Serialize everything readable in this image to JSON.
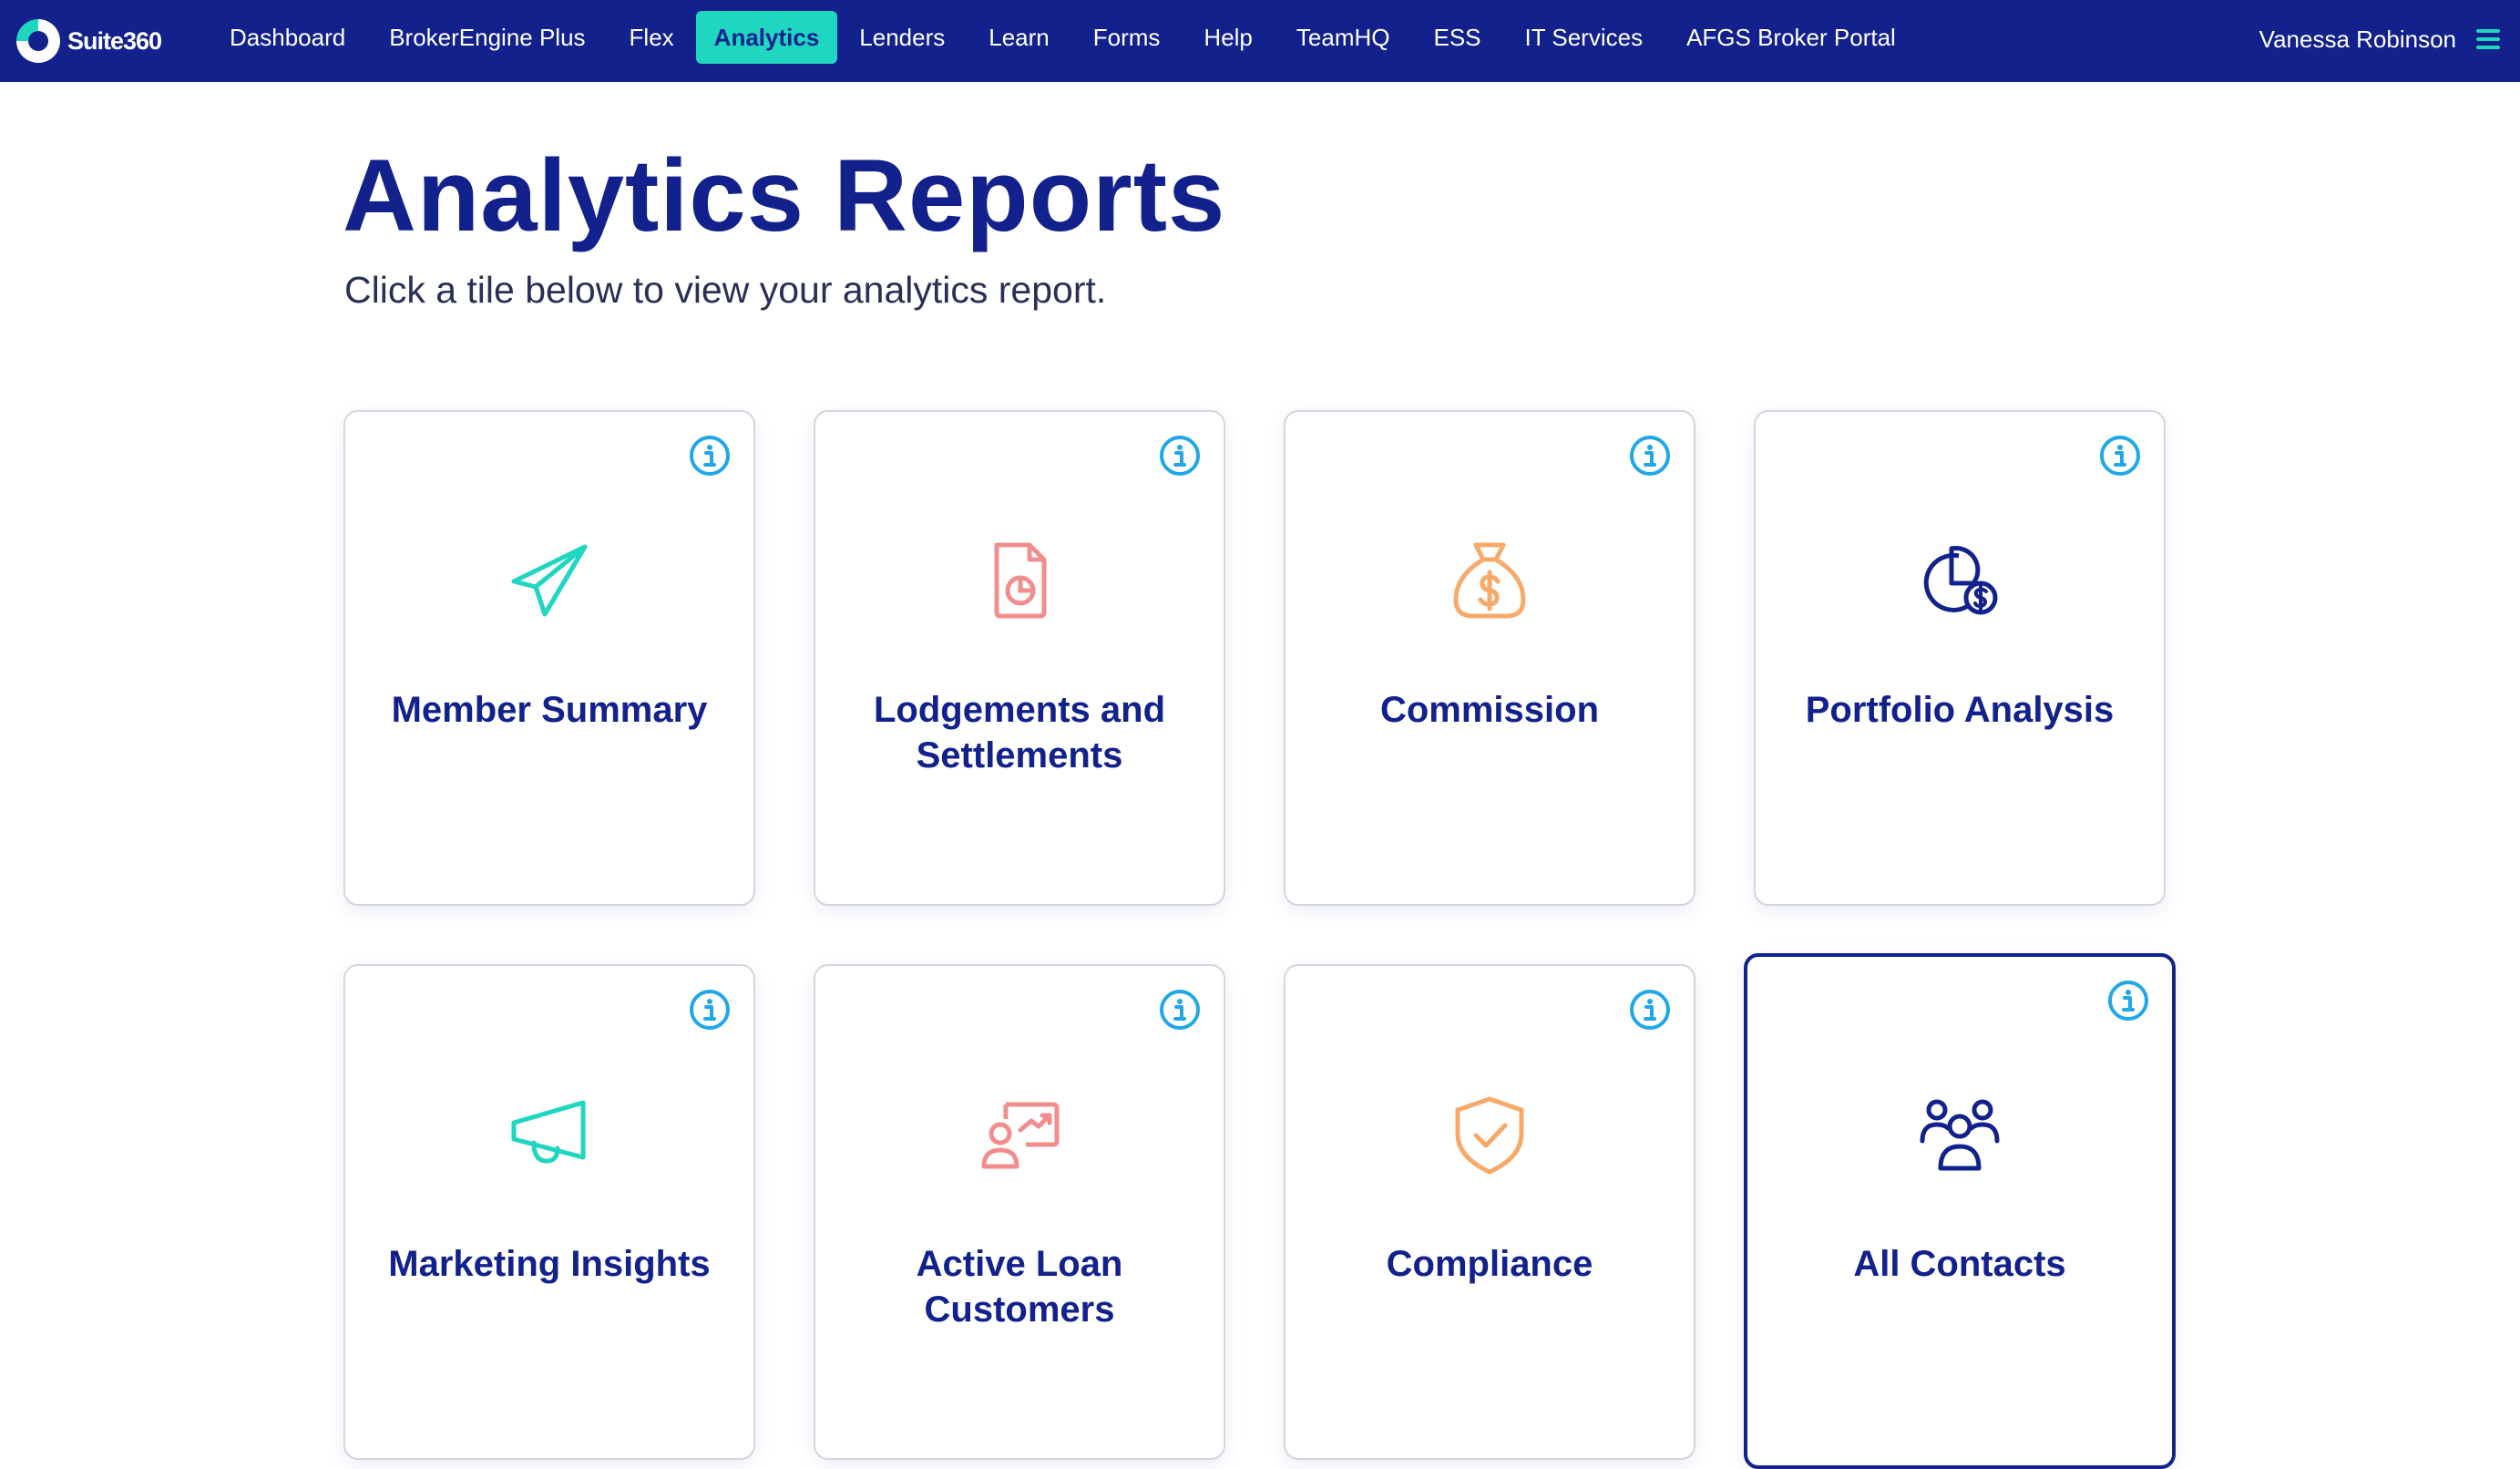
{
  "app": {
    "name": "Suite360"
  },
  "nav": {
    "items": [
      {
        "label": "Dashboard"
      },
      {
        "label": "BrokerEngine Plus"
      },
      {
        "label": "Flex"
      },
      {
        "label": "Analytics",
        "active": true
      },
      {
        "label": "Lenders"
      },
      {
        "label": "Learn"
      },
      {
        "label": "Forms"
      },
      {
        "label": "Help"
      },
      {
        "label": "TeamHQ"
      },
      {
        "label": "ESS"
      },
      {
        "label": "IT Services"
      },
      {
        "label": "AFGS Broker Portal"
      }
    ],
    "user_name": "Vanessa Robinson"
  },
  "page": {
    "title": "Analytics Reports",
    "subtitle": "Click a tile below to view your analytics report."
  },
  "tiles": [
    {
      "label": "Member Summary",
      "icon": "paper-plane-icon",
      "color": "#1fd6c1"
    },
    {
      "label": "Lodgements and Settlements",
      "icon": "document-pie-icon",
      "color": "#f28d8d"
    },
    {
      "label": "Commission",
      "icon": "money-bag-icon",
      "color": "#f7a96a"
    },
    {
      "label": "Portfolio Analysis",
      "icon": "pie-dollar-icon",
      "color": "#12218c"
    },
    {
      "label": "Marketing Insights",
      "icon": "megaphone-icon",
      "color": "#1fd6c1"
    },
    {
      "label": "Active Loan Customers",
      "icon": "customer-growth-icon",
      "color": "#f28d8d"
    },
    {
      "label": "Compliance",
      "icon": "shield-check-icon",
      "color": "#f7a96a"
    },
    {
      "label": "All Contacts",
      "icon": "people-group-icon",
      "color": "#12218c",
      "selected": true
    }
  ],
  "colors": {
    "brand_navy": "#12218c",
    "accent_teal": "#1fd6c1",
    "info_blue": "#1fa7e8",
    "coral": "#f28d8d",
    "orange": "#f7a96a"
  }
}
